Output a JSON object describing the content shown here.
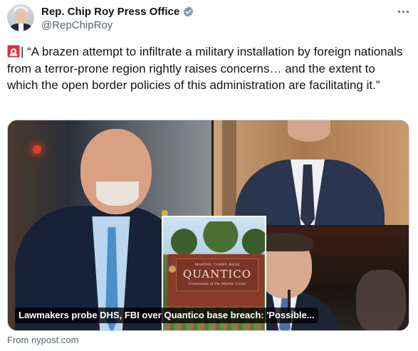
{
  "author": {
    "display_name": "Rep. Chip Roy Press Office",
    "handle": "@RepChipRoy",
    "verified": true,
    "avatar_icon": "profile-photo"
  },
  "tweet": {
    "lead_icon": "rotating-light-emoji",
    "text": "| “A brazen attempt to infiltrate a military installation by foreign nationals from a terror-prone region rightly raises concerns… and the extent to which the open border policies of this administration are facilitating it.”"
  },
  "card": {
    "sign": {
      "top_text": "MARINE CORPS BASE",
      "main_text": "QUANTICO",
      "sub_text": "Crossroads of the Marine Corps"
    },
    "headline": "Lawmakers probe DHS, FBI over Quantico base breach: 'Possible...",
    "source": "From nypost.com"
  },
  "colors": {
    "text_primary": "#0f1419",
    "text_secondary": "#536471",
    "verified_badge": "#829aab",
    "border": "#cfd9de"
  }
}
